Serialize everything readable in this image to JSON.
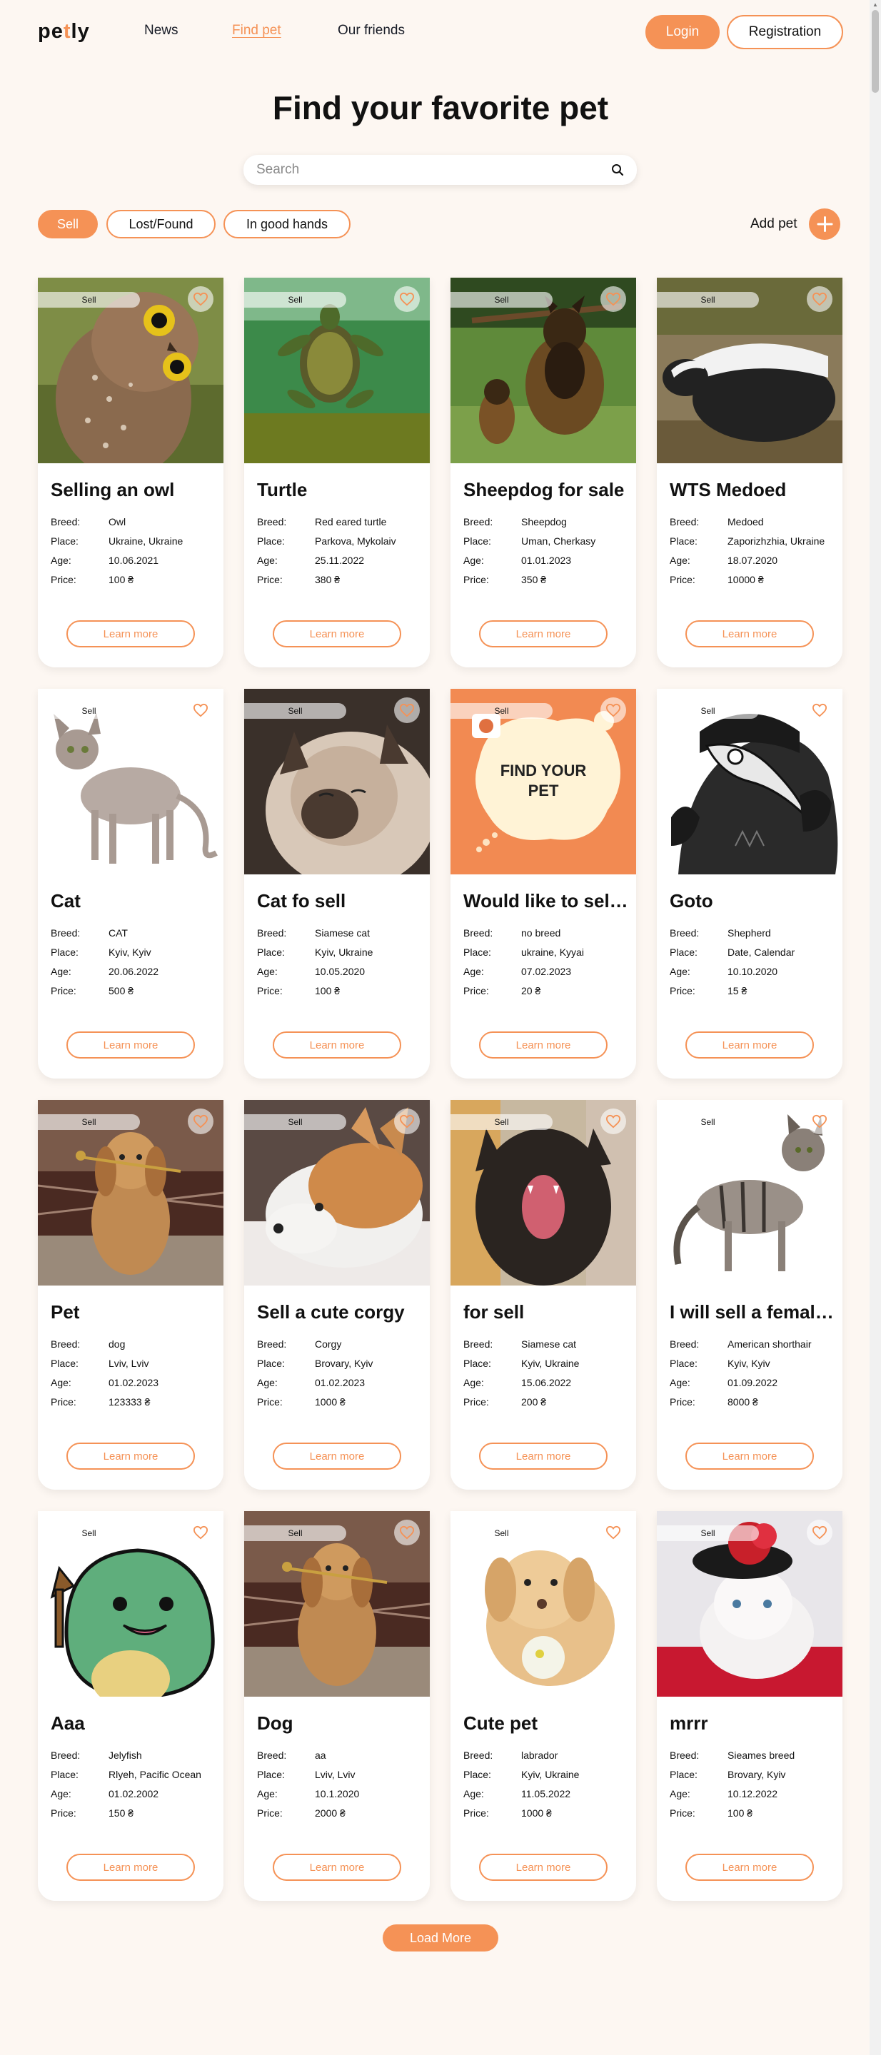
{
  "header": {
    "logo_left": "pe",
    "logo_accent": "t",
    "logo_right": "ly",
    "nav": [
      "News",
      "Find pet",
      "Our friends"
    ],
    "login": "Login",
    "registration": "Registration"
  },
  "title": "Find your favorite pet",
  "search": {
    "placeholder": "Search"
  },
  "filters": [
    "Sell",
    "Lost/Found",
    "In good hands"
  ],
  "add_pet": "Add pet",
  "labels": {
    "breed": "Breed:",
    "place": "Place:",
    "age": "Age:",
    "price": "Price:",
    "learn_more": "Learn more"
  },
  "pets": [
    {
      "category": "Sell",
      "title": "Selling an owl",
      "breed": "Owl",
      "place": "Ukraine, Ukraine",
      "age": "10.06.2021",
      "price": "100 ₴",
      "image": "owl"
    },
    {
      "category": "Sell",
      "title": "Turtle",
      "breed": "Red eared turtle",
      "place": "Parkova, Mykolaiv",
      "age": "25.11.2022",
      "price": "380 ₴",
      "image": "turtle"
    },
    {
      "category": "Sell",
      "title": "Sheepdog for sale",
      "breed": "Sheepdog",
      "place": "Uman, Cherkasy",
      "age": "01.01.2023",
      "price": "350 ₴",
      "image": "sheepdog"
    },
    {
      "category": "Sell",
      "title": "WTS Medoed",
      "breed": "Medoed",
      "place": "Zaporizhzhia, Ukraine",
      "age": "18.07.2020",
      "price": "10000 ₴",
      "image": "badger"
    },
    {
      "category": "Sell",
      "title": "Cat",
      "breed": "CAT",
      "place": "Kyiv, Kyiv",
      "age": "20.06.2022",
      "price": "500 ₴",
      "image": "sphynx-cat"
    },
    {
      "category": "Sell",
      "title": "Cat fo sell",
      "breed": "Siamese cat",
      "place": "Kyiv, Ukraine",
      "age": "10.05.2020",
      "price": "100 ₴",
      "image": "siamese-cat"
    },
    {
      "category": "Sell",
      "title": "Would like to sell my...",
      "breed": "no breed",
      "place": "ukraine, Kyyai",
      "age": "07.02.2023",
      "price": "20 ₴",
      "image": "find-your-pet-poster",
      "poster_text": [
        "FIND YOUR",
        "PET"
      ]
    },
    {
      "category": "Sell",
      "title": "Goto",
      "breed": "Shepherd",
      "place": "Date, Calendar",
      "age": "10.10.2020",
      "price": "15 ₴",
      "image": "plague-doctor"
    },
    {
      "category": "Sell",
      "title": "Pet",
      "breed": "dog",
      "place": "Lviv, Lviv",
      "age": "01.02.2023",
      "price": "123333 ₴",
      "image": "golden-puppy"
    },
    {
      "category": "Sell",
      "title": "Sell a cute corgy",
      "breed": "Corgy",
      "place": "Brovary, Kyiv",
      "age": "01.02.2023",
      "price": "1000 ₴",
      "image": "corgi"
    },
    {
      "category": "Sell",
      "title": "for sell",
      "breed": "Siamese cat",
      "place": "Kyiv, Ukraine",
      "age": "15.06.2022",
      "price": "200 ₴",
      "image": "yawning-cat"
    },
    {
      "category": "Sell",
      "title": "I will sell a female cat",
      "breed": "American shorthair",
      "place": "Kyiv, Kyiv",
      "age": "01.09.2022",
      "price": "8000 ₴",
      "image": "tabby-cat"
    },
    {
      "category": "Sell",
      "title": "Aaa",
      "breed": "Jelyfish",
      "place": "Rlyeh, Pacific Ocean",
      "age": "01.02.2002",
      "price": "150 ₴",
      "image": "green-blob"
    },
    {
      "category": "Sell",
      "title": "Dog",
      "breed": "aa",
      "place": "Lviv, Lviv",
      "age": "10.1.2020",
      "price": "2000 ₴",
      "image": "golden-puppy"
    },
    {
      "category": "Sell",
      "title": "Cute pet",
      "breed": "labrador",
      "place": "Kyiv, Ukraine",
      "age": "11.05.2022",
      "price": "1000 ₴",
      "image": "lab-puppy"
    },
    {
      "category": "Sell",
      "title": "mrrr",
      "breed": "Sieames breed",
      "place": "Brovary, Kyiv",
      "age": "10.12.2022",
      "price": "100 ₴",
      "image": "persian-cat"
    }
  ],
  "load_more": "Load More",
  "icons": {
    "search": "search-icon",
    "favorite": "heart-icon",
    "add": "plus-icon"
  },
  "colors": {
    "accent": "#f59256",
    "background": "#fdf7f2"
  }
}
